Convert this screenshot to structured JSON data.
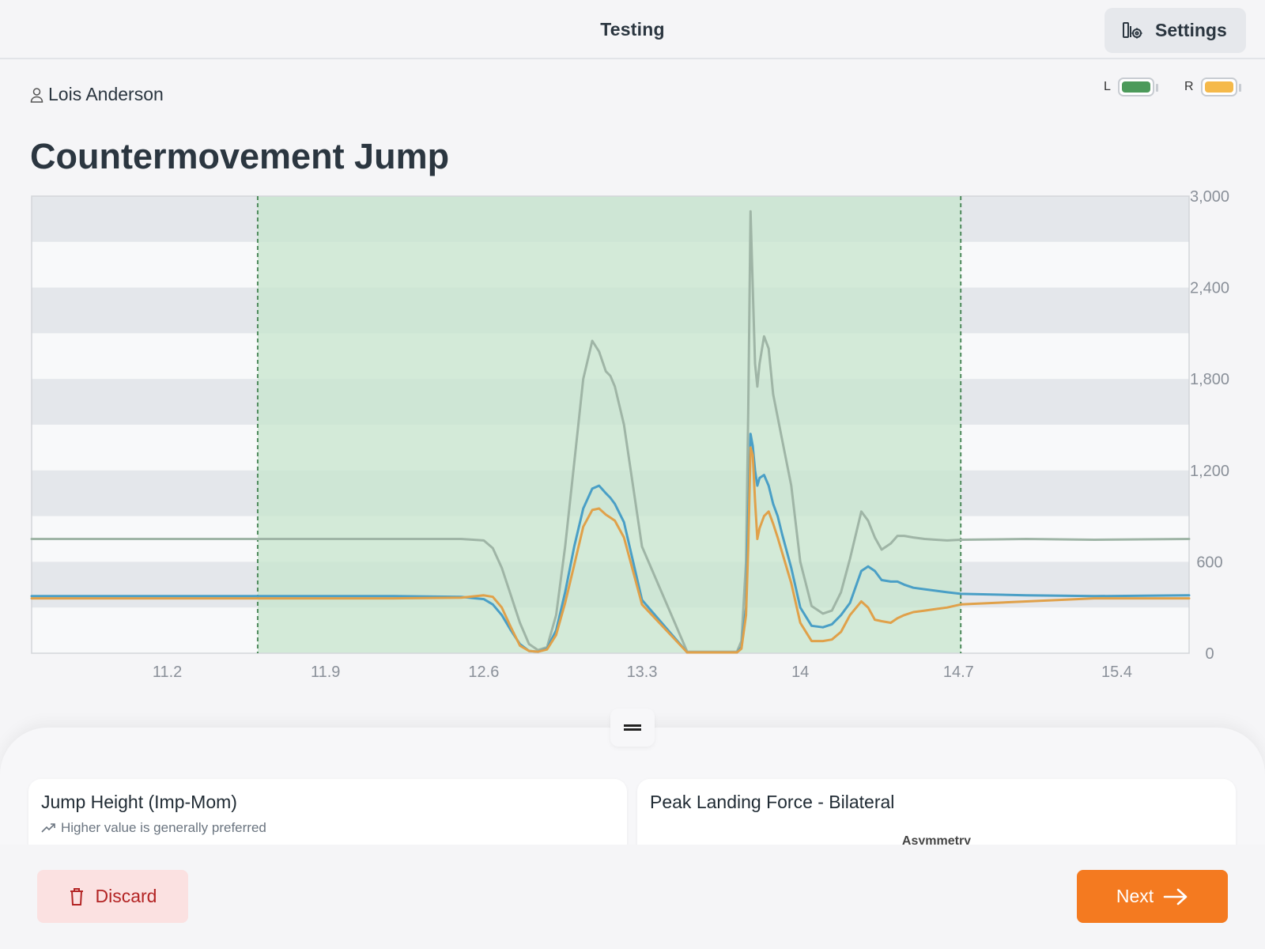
{
  "header": {
    "title": "Testing",
    "settings_label": "Settings"
  },
  "user": {
    "name": "Lois Anderson"
  },
  "devices": [
    {
      "label": "L",
      "color": "#4c9a5a"
    },
    {
      "label": "R",
      "color": "#f5b94a"
    }
  ],
  "page_title": "Countermovement Jump",
  "chart_data": {
    "type": "line",
    "x_ticks": [
      "11.2",
      "11.9",
      "12.6",
      "13.3",
      "14",
      "14.7",
      "15.4"
    ],
    "y_ticks": [
      "0",
      "600",
      "1,200",
      "1,800",
      "2,400",
      "3,000"
    ],
    "xlim": [
      10.6,
      15.72
    ],
    "ylim": [
      0,
      3000
    ],
    "highlight_range": [
      11.6,
      14.71
    ],
    "grid": "horizontal bands",
    "colors": {
      "total": "#9fb5a6",
      "left": "#4a9fc6",
      "right": "#e0a14a",
      "highlight": "#c8e6ce"
    },
    "series": [
      {
        "x": [
          10.6,
          11.0,
          11.4,
          11.8,
          12.2,
          12.5,
          12.6,
          12.64,
          12.68,
          12.72,
          12.76,
          12.8,
          12.84,
          12.88,
          12.92,
          12.96,
          13.0,
          13.04,
          13.08,
          13.11,
          13.14,
          13.16,
          13.18,
          13.22,
          13.3,
          13.5,
          13.65,
          13.72,
          13.74,
          13.76,
          13.77,
          13.78,
          13.79,
          13.8,
          13.81,
          13.82,
          13.84,
          13.86,
          13.88,
          13.9,
          13.92,
          13.96,
          14.0,
          14.05,
          14.1,
          14.14,
          14.18,
          14.22,
          14.27,
          14.3,
          14.33,
          14.36,
          14.4,
          14.43,
          14.46,
          14.5,
          14.55,
          14.6,
          14.65,
          14.71,
          15.0,
          15.3,
          15.72
        ],
        "values": [
          750,
          750,
          750,
          750,
          750,
          750,
          740,
          690,
          560,
          380,
          200,
          60,
          20,
          40,
          250,
          700,
          1250,
          1800,
          2050,
          1980,
          1850,
          1820,
          1750,
          1500,
          700,
          10,
          10,
          10,
          80,
          600,
          1600,
          2900,
          2400,
          1900,
          1750,
          1900,
          2080,
          2000,
          1700,
          1550,
          1400,
          1100,
          600,
          310,
          260,
          280,
          400,
          620,
          930,
          870,
          760,
          680,
          720,
          770,
          770,
          760,
          750,
          745,
          740,
          745,
          750,
          745,
          750
        ]
      },
      {
        "x": [
          10.6,
          11.0,
          11.4,
          11.8,
          12.2,
          12.5,
          12.6,
          12.64,
          12.68,
          12.72,
          12.76,
          12.8,
          12.84,
          12.88,
          12.92,
          12.96,
          13.0,
          13.04,
          13.08,
          13.11,
          13.14,
          13.16,
          13.18,
          13.22,
          13.3,
          13.5,
          13.65,
          13.72,
          13.74,
          13.76,
          13.77,
          13.78,
          13.79,
          13.8,
          13.81,
          13.82,
          13.84,
          13.86,
          13.88,
          13.9,
          13.92,
          13.96,
          14.0,
          14.05,
          14.1,
          14.14,
          14.18,
          14.22,
          14.27,
          14.3,
          14.33,
          14.36,
          14.4,
          14.43,
          14.46,
          14.5,
          14.55,
          14.6,
          14.65,
          14.71,
          15.0,
          15.3,
          15.72
        ],
        "values": [
          375,
          375,
          375,
          375,
          375,
          370,
          355,
          320,
          250,
          150,
          60,
          15,
          10,
          30,
          150,
          400,
          700,
          950,
          1080,
          1100,
          1050,
          1020,
          980,
          860,
          350,
          5,
          5,
          5,
          40,
          300,
          900,
          1440,
          1360,
          1200,
          1100,
          1150,
          1170,
          1100,
          980,
          900,
          780,
          560,
          300,
          180,
          170,
          190,
          250,
          330,
          540,
          570,
          540,
          480,
          470,
          470,
          450,
          430,
          420,
          410,
          400,
          390,
          380,
          375,
          380
        ]
      },
      {
        "x": [
          10.6,
          11.0,
          11.4,
          11.8,
          12.2,
          12.5,
          12.6,
          12.64,
          12.68,
          12.72,
          12.76,
          12.8,
          12.84,
          12.88,
          12.92,
          12.96,
          13.0,
          13.04,
          13.08,
          13.11,
          13.14,
          13.16,
          13.18,
          13.22,
          13.3,
          13.5,
          13.65,
          13.72,
          13.74,
          13.76,
          13.77,
          13.78,
          13.79,
          13.8,
          13.81,
          13.82,
          13.84,
          13.86,
          13.88,
          13.9,
          13.92,
          13.96,
          14.0,
          14.05,
          14.1,
          14.14,
          14.18,
          14.22,
          14.27,
          14.3,
          14.33,
          14.36,
          14.4,
          14.43,
          14.46,
          14.5,
          14.55,
          14.6,
          14.65,
          14.71,
          15.0,
          15.3,
          15.72
        ],
        "values": [
          360,
          360,
          360,
          360,
          360,
          365,
          380,
          370,
          300,
          170,
          50,
          15,
          10,
          25,
          120,
          330,
          580,
          830,
          940,
          950,
          910,
          890,
          870,
          760,
          320,
          5,
          5,
          5,
          30,
          250,
          700,
          1350,
          1300,
          1000,
          750,
          820,
          900,
          930,
          850,
          760,
          660,
          460,
          200,
          80,
          80,
          90,
          140,
          250,
          340,
          300,
          220,
          210,
          200,
          230,
          250,
          270,
          280,
          290,
          300,
          320,
          340,
          360,
          360
        ]
      }
    ]
  },
  "cards": [
    {
      "title": "Jump Height (Imp-Mom)",
      "subtitle": "Higher value is generally preferred"
    },
    {
      "title": "Peak Landing Force - Bilateral",
      "section": "Asymmetry"
    }
  ],
  "footer": {
    "discard_label": "Discard",
    "next_label": "Next"
  }
}
